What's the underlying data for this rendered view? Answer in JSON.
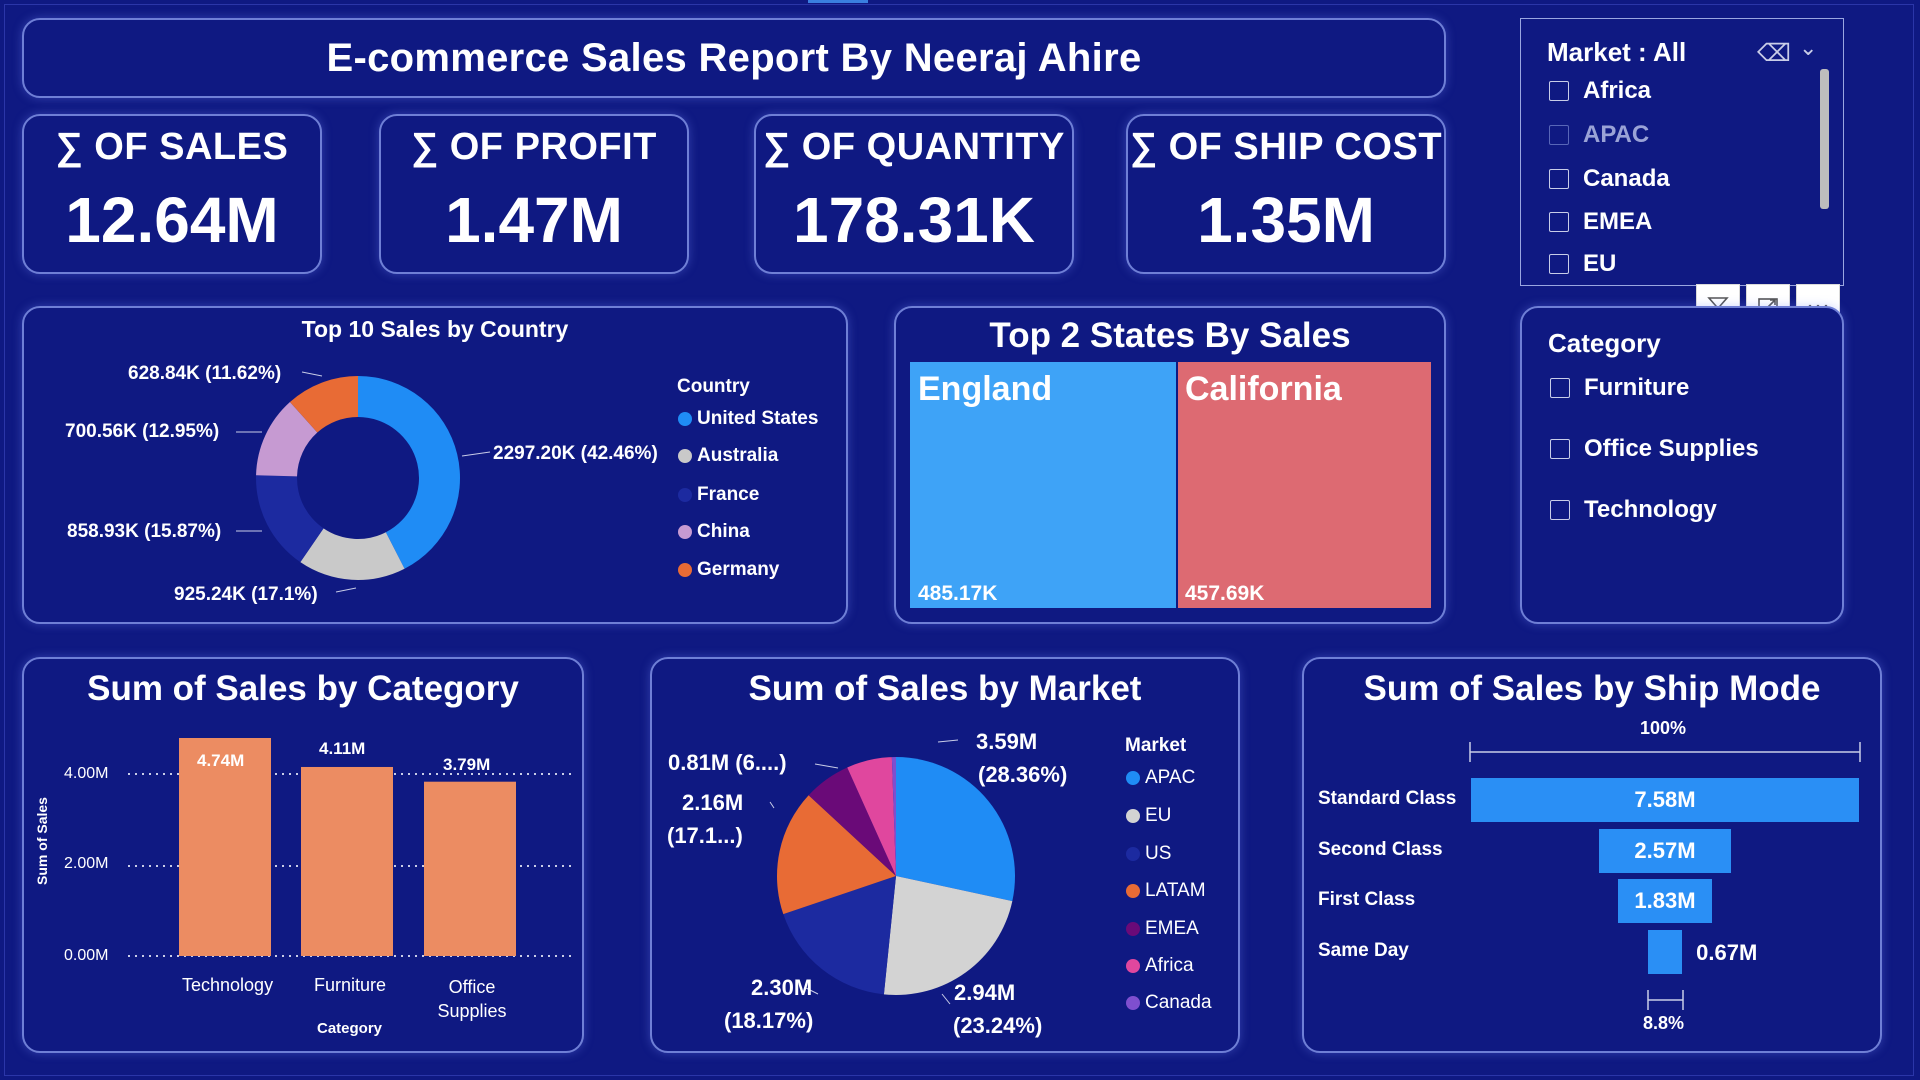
{
  "report": {
    "title": "E-commerce Sales Report By Neeraj Ahire"
  },
  "kpis": [
    {
      "label": "∑ OF SALES",
      "value": "12.64M"
    },
    {
      "label": "∑ OF PROFIT",
      "value": "1.47M"
    },
    {
      "label": "∑ OF QUANTITY",
      "value": "178.31K"
    },
    {
      "label": "∑ OF SHIP COST",
      "value": "1.35M"
    }
  ],
  "market_slicer": {
    "title": "Market : All",
    "items": [
      "Africa",
      "APAC",
      "Canada",
      "EMEA",
      "EU"
    ],
    "icons": {
      "clear": "eraser-icon",
      "expand": "chevron-down-icon"
    }
  },
  "visual_toolbar": {
    "filter": "filter-icon",
    "focus": "focus-mode-icon",
    "more": "more-options-icon",
    "more_glyph": "···"
  },
  "category_slicer": {
    "title": "Category",
    "items": [
      "Furniture",
      "Office Supplies",
      "Technology"
    ]
  },
  "colors": {
    "background": "#0f1982",
    "card_border": "#6f7fd6",
    "united_states": "#1f8cf5",
    "australia": "#c9c9c9",
    "france": "#1c2aa0",
    "china": "#c69ad2",
    "germany": "#e86b35",
    "bar": "#ec8c62",
    "england": "#3ea3f7",
    "california": "#dd6a72",
    "apac": "#1f8cf5",
    "eu": "#d3d3d3",
    "us": "#1c2aa0",
    "latam": "#e86b35",
    "emea": "#6a0a78",
    "africa": "#e0479e",
    "canada": "#7e4fcf"
  },
  "chart_data": [
    {
      "id": "country",
      "type": "pie",
      "title": "Top 10 Sales by Country",
      "legend_title": "Country",
      "legend_position": "right",
      "categories": [
        "United States",
        "Australia",
        "France",
        "China",
        "Germany"
      ],
      "values": [
        2297.2,
        925.24,
        858.93,
        700.56,
        628.84
      ],
      "labels": [
        "2297.20K (42.46%)",
        "925.24K (17.1%)",
        "858.93K (15.87%)",
        "700.56K (12.95%)",
        "628.84K (11.62%)"
      ]
    },
    {
      "id": "states",
      "type": "treemap",
      "title": "Top 2 States By Sales",
      "categories": [
        "England",
        "California"
      ],
      "values": [
        485.17,
        457.69
      ],
      "labels": [
        "485.17K",
        "457.69K"
      ]
    },
    {
      "id": "category",
      "type": "bar",
      "title": "Sum of Sales by Category",
      "xlabel": "Category",
      "ylabel": "Sum of Sales",
      "categories": [
        "Technology",
        "Furniture",
        "Office\nSupplies"
      ],
      "values": [
        4.74,
        4.11,
        3.79
      ],
      "labels": [
        "4.74M",
        "4.11M",
        "3.79M"
      ],
      "yticks": [
        "0.00M",
        "2.00M",
        "4.00M"
      ],
      "ylim": [
        0,
        4.74
      ],
      "grid": true
    },
    {
      "id": "market",
      "type": "pie",
      "title": "Sum of Sales by Market",
      "legend_title": "Market",
      "legend_position": "right",
      "categories": [
        "APAC",
        "EU",
        "US",
        "LATAM",
        "EMEA",
        "Africa",
        "Canada"
      ],
      "values": [
        3.59,
        2.94,
        2.3,
        2.16,
        0.81,
        0.78,
        0.07
      ],
      "labels": {
        "APAC": [
          "3.59M",
          "(28.36%)"
        ],
        "EU": [
          "2.94M",
          "(23.24%)"
        ],
        "US": [
          "2.30M",
          "(18.17%)"
        ],
        "LATAM": [
          "2.16M",
          "(17.1...)"
        ],
        "EMEA": [
          "0.81M (6....)"
        ]
      }
    },
    {
      "id": "shipmode",
      "type": "funnel",
      "title": "Sum of Sales by Ship Mode",
      "categories": [
        "Standard Class",
        "Second Class",
        "First Class",
        "Same Day"
      ],
      "values": [
        7.58,
        2.57,
        1.83,
        0.67
      ],
      "labels": [
        "7.58M",
        "2.57M",
        "1.83M",
        "0.67M"
      ],
      "top_percent": "100%",
      "bottom_percent": "8.8%"
    }
  ]
}
